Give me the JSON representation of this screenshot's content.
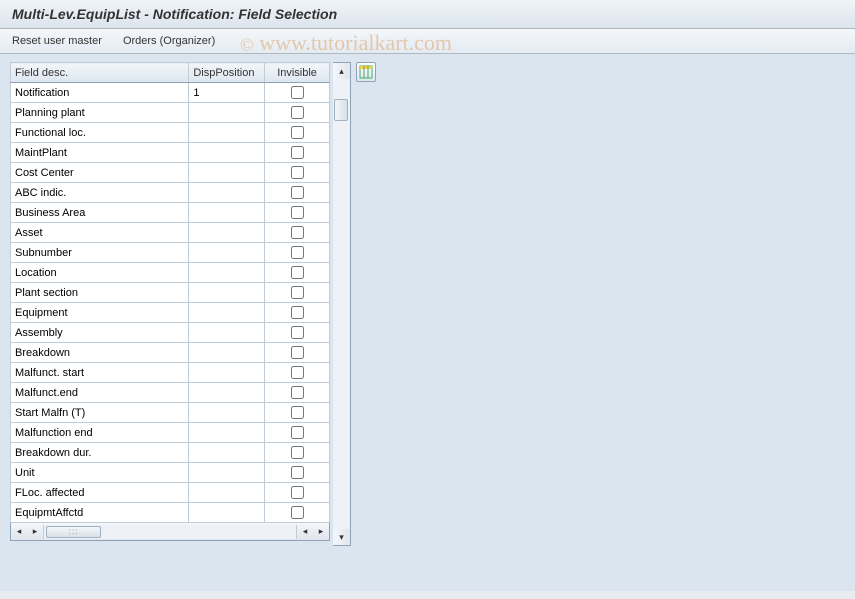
{
  "title": "Multi-Lev.EquipList - Notification: Field Selection",
  "toolbar": {
    "reset": "Reset user master",
    "orders": "Orders (Organizer)"
  },
  "columns": {
    "desc": "Field desc.",
    "pos": "DispPosition",
    "inv": "Invisible"
  },
  "rows": [
    {
      "desc": "Notification",
      "pos": "1",
      "inv": false
    },
    {
      "desc": "Planning plant",
      "pos": "",
      "inv": false
    },
    {
      "desc": "Functional loc.",
      "pos": "",
      "inv": false
    },
    {
      "desc": "MaintPlant",
      "pos": "",
      "inv": false
    },
    {
      "desc": "Cost Center",
      "pos": "",
      "inv": false
    },
    {
      "desc": "ABC indic.",
      "pos": "",
      "inv": false
    },
    {
      "desc": "Business Area",
      "pos": "",
      "inv": false
    },
    {
      "desc": "Asset",
      "pos": "",
      "inv": false
    },
    {
      "desc": "Subnumber",
      "pos": "",
      "inv": false
    },
    {
      "desc": "Location",
      "pos": "",
      "inv": false
    },
    {
      "desc": "Plant section",
      "pos": "",
      "inv": false
    },
    {
      "desc": "Equipment",
      "pos": "",
      "inv": false
    },
    {
      "desc": "Assembly",
      "pos": "",
      "inv": false
    },
    {
      "desc": "Breakdown",
      "pos": "",
      "inv": false
    },
    {
      "desc": "Malfunct. start",
      "pos": "",
      "inv": false
    },
    {
      "desc": "Malfunct.end",
      "pos": "",
      "inv": false
    },
    {
      "desc": "Start Malfn (T)",
      "pos": "",
      "inv": false
    },
    {
      "desc": "Malfunction end",
      "pos": "",
      "inv": false
    },
    {
      "desc": "Breakdown dur.",
      "pos": "",
      "inv": false
    },
    {
      "desc": "Unit",
      "pos": "",
      "inv": false
    },
    {
      "desc": "FLoc. affected",
      "pos": "",
      "inv": false
    },
    {
      "desc": "EquipmtAffctd",
      "pos": "",
      "inv": false
    }
  ],
  "watermark": "www.tutorialkart.com"
}
